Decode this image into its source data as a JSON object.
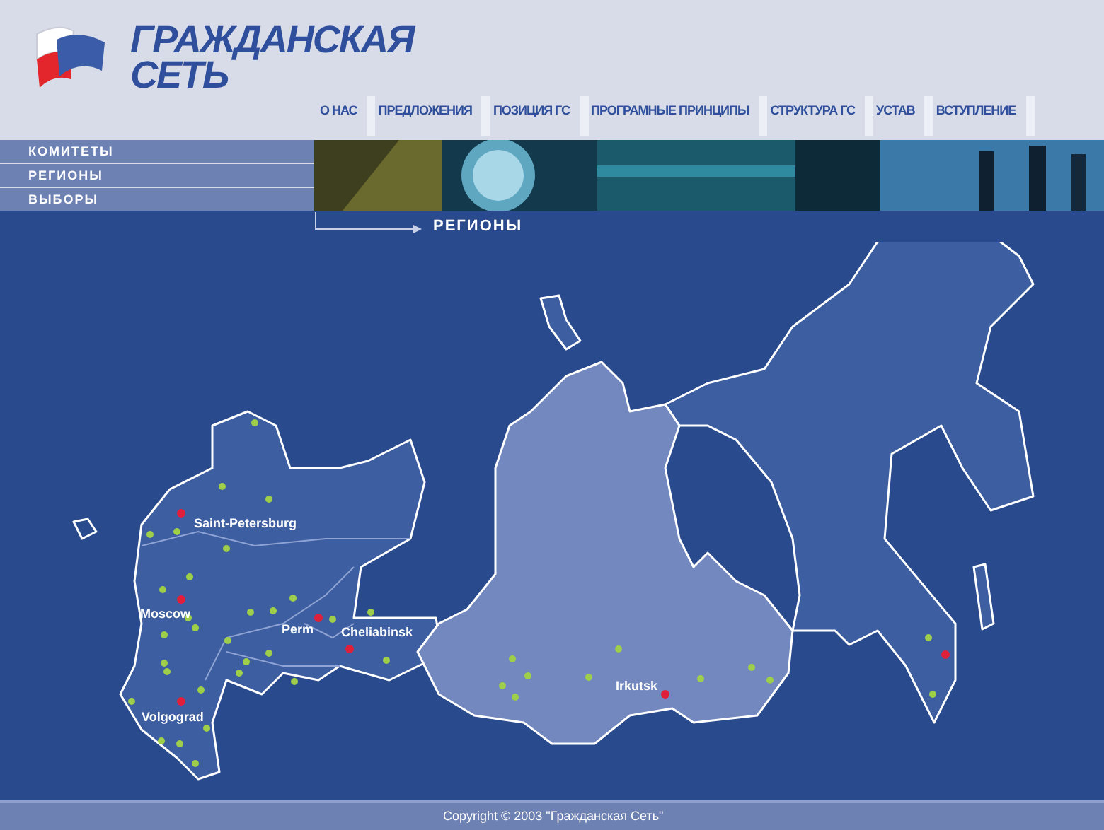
{
  "logo": {
    "lines": [
      "ГРАЖДАНСКАЯ",
      "СЕТЬ"
    ]
  },
  "nav": [
    {
      "label": "О НАС"
    },
    {
      "label": "ПРЕДЛОЖЕНИЯ"
    },
    {
      "label": "ПОЗИЦИЯ ГС"
    },
    {
      "label": "ПРОГРАМНЫЕ ПРИНЦИПЫ"
    },
    {
      "label": "СТРУКТУРА ГС"
    },
    {
      "label": "УСТАВ"
    },
    {
      "label": "ВСТУПЛЕНИЕ"
    }
  ],
  "sidebar": {
    "items": [
      {
        "label": "КОМИТЕТЫ"
      },
      {
        "label": "РЕГИОНЫ"
      },
      {
        "label": "ВЫБОРЫ"
      }
    ]
  },
  "breadcrumb": "РЕГИОНЫ",
  "map": {
    "cities": [
      {
        "label": "Saint-Petersburg"
      },
      {
        "label": "Moscow"
      },
      {
        "label": "Perm"
      },
      {
        "label": "Cheliabinsk"
      },
      {
        "label": "Volgograd"
      },
      {
        "label": "Irkutsk"
      }
    ]
  },
  "footer": "Copyright © 2003 \"Гражданская Сеть\""
}
